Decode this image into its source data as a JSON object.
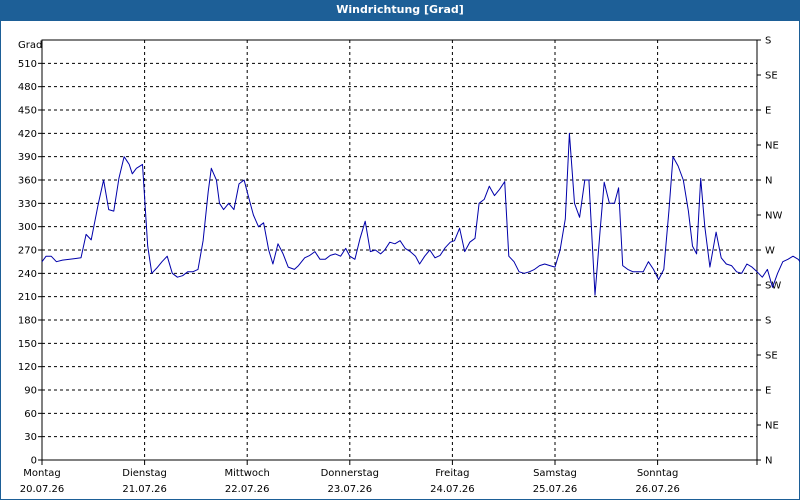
{
  "window": {
    "title": "Windrichtung [Grad]"
  },
  "chart_data": {
    "type": "line",
    "title": "Windrichtung [Grad]",
    "ylabel": "Grad",
    "ylim": [
      0,
      540
    ],
    "yticks": [
      0,
      30,
      60,
      90,
      120,
      150,
      180,
      210,
      240,
      270,
      300,
      330,
      360,
      390,
      420,
      450,
      480,
      510
    ],
    "right_axis_labels": [
      "N",
      "NE",
      "E",
      "SE",
      "S",
      "SW",
      "W",
      "NW",
      "N",
      "NE",
      "E",
      "SE",
      "S"
    ],
    "grid": true,
    "days": [
      {
        "name": "Montag",
        "date": "20.07.26"
      },
      {
        "name": "Dienstag",
        "date": "21.07.26"
      },
      {
        "name": "Mittwoch",
        "date": "22.07.26"
      },
      {
        "name": "Donnerstag",
        "date": "23.07.26"
      },
      {
        "name": "Freitag",
        "date": "24.07.26"
      },
      {
        "name": "Samstag",
        "date": "25.07.26"
      },
      {
        "name": "Sonntag",
        "date": "26.07.26"
      }
    ],
    "series": [
      {
        "color": "#0000aa",
        "x_unit": "days since Montag 20.07.26 00:00",
        "points": [
          [
            0.0,
            255
          ],
          [
            0.04,
            262
          ],
          [
            0.09,
            262
          ],
          [
            0.14,
            255
          ],
          [
            0.2,
            257
          ],
          [
            0.32,
            259
          ],
          [
            0.38,
            260
          ],
          [
            0.43,
            290
          ],
          [
            0.48,
            283
          ],
          [
            0.55,
            330
          ],
          [
            0.6,
            360
          ],
          [
            0.65,
            322
          ],
          [
            0.7,
            320
          ],
          [
            0.75,
            362
          ],
          [
            0.8,
            390
          ],
          [
            0.85,
            380
          ],
          [
            0.88,
            368
          ],
          [
            0.92,
            375
          ],
          [
            0.98,
            380
          ],
          [
            1.03,
            275
          ],
          [
            1.07,
            240
          ],
          [
            1.12,
            247
          ],
          [
            1.17,
            255
          ],
          [
            1.22,
            262
          ],
          [
            1.27,
            240
          ],
          [
            1.32,
            235
          ],
          [
            1.37,
            237
          ],
          [
            1.42,
            242
          ],
          [
            1.47,
            242
          ],
          [
            1.52,
            245
          ],
          [
            1.57,
            282
          ],
          [
            1.62,
            345
          ],
          [
            1.65,
            375
          ],
          [
            1.7,
            360
          ],
          [
            1.73,
            330
          ],
          [
            1.77,
            322
          ],
          [
            1.82,
            330
          ],
          [
            1.87,
            322
          ],
          [
            1.92,
            355
          ],
          [
            1.97,
            360
          ],
          [
            2.01,
            340
          ],
          [
            2.06,
            315
          ],
          [
            2.11,
            300
          ],
          [
            2.16,
            305
          ],
          [
            2.21,
            270
          ],
          [
            2.25,
            252
          ],
          [
            2.3,
            278
          ],
          [
            2.35,
            265
          ],
          [
            2.4,
            248
          ],
          [
            2.46,
            245
          ],
          [
            2.5,
            250
          ],
          [
            2.56,
            260
          ],
          [
            2.61,
            263
          ],
          [
            2.66,
            268
          ],
          [
            2.71,
            258
          ],
          [
            2.76,
            258
          ],
          [
            2.81,
            263
          ],
          [
            2.86,
            265
          ],
          [
            2.91,
            262
          ],
          [
            2.96,
            272
          ],
          [
            3.0,
            262
          ],
          [
            3.05,
            258
          ],
          [
            3.1,
            285
          ],
          [
            3.15,
            307
          ],
          [
            3.2,
            268
          ],
          [
            3.25,
            270
          ],
          [
            3.3,
            265
          ],
          [
            3.34,
            270
          ],
          [
            3.39,
            280
          ],
          [
            3.44,
            278
          ],
          [
            3.49,
            282
          ],
          [
            3.54,
            272
          ],
          [
            3.59,
            268
          ],
          [
            3.64,
            262
          ],
          [
            3.68,
            252
          ],
          [
            3.73,
            262
          ],
          [
            3.78,
            270
          ],
          [
            3.83,
            260
          ],
          [
            3.88,
            263
          ],
          [
            3.93,
            273
          ],
          [
            3.98,
            280
          ],
          [
            4.02,
            282
          ],
          [
            4.07,
            298
          ],
          [
            4.12,
            268
          ],
          [
            4.17,
            280
          ],
          [
            4.22,
            285
          ],
          [
            4.26,
            330
          ],
          [
            4.31,
            335
          ],
          [
            4.36,
            352
          ],
          [
            4.41,
            340
          ],
          [
            4.46,
            348
          ],
          [
            4.51,
            358
          ],
          [
            4.55,
            262
          ],
          [
            4.6,
            255
          ],
          [
            4.65,
            242
          ],
          [
            4.7,
            240
          ],
          [
            4.75,
            242
          ],
          [
            4.8,
            245
          ],
          [
            4.85,
            250
          ],
          [
            4.9,
            252
          ],
          [
            4.95,
            250
          ],
          [
            5.0,
            248
          ],
          [
            5.05,
            270
          ],
          [
            5.1,
            310
          ],
          [
            5.14,
            420
          ],
          [
            5.19,
            330
          ],
          [
            5.24,
            312
          ],
          [
            5.29,
            360
          ],
          [
            5.33,
            360
          ],
          [
            5.39,
            212
          ],
          [
            5.44,
            295
          ],
          [
            5.48,
            357
          ],
          [
            5.53,
            330
          ],
          [
            5.58,
            330
          ],
          [
            5.62,
            350
          ],
          [
            5.66,
            250
          ],
          [
            5.71,
            245
          ],
          [
            5.76,
            242
          ],
          [
            5.81,
            242
          ],
          [
            5.86,
            242
          ],
          [
            5.91,
            255
          ],
          [
            5.96,
            245
          ],
          [
            6.01,
            232
          ],
          [
            6.06,
            245
          ],
          [
            6.11,
            320
          ],
          [
            6.15,
            390
          ],
          [
            6.2,
            378
          ],
          [
            6.25,
            360
          ],
          [
            6.3,
            320
          ],
          [
            6.34,
            275
          ],
          [
            6.38,
            265
          ],
          [
            6.42,
            362
          ],
          [
            6.46,
            300
          ],
          [
            6.51,
            248
          ],
          [
            6.57,
            293
          ],
          [
            6.62,
            260
          ],
          [
            6.67,
            252
          ],
          [
            6.72,
            250
          ],
          [
            6.77,
            242
          ],
          [
            6.82,
            240
          ],
          [
            6.87,
            252
          ],
          [
            6.92,
            248
          ],
          [
            6.97,
            242
          ],
          [
            7.02,
            235
          ],
          [
            7.07,
            245
          ],
          [
            7.12,
            222
          ],
          [
            7.17,
            240
          ],
          [
            7.22,
            255
          ],
          [
            7.27,
            258
          ],
          [
            7.32,
            262
          ],
          [
            7.37,
            258
          ],
          [
            7.42,
            250
          ],
          [
            7.47,
            255
          ],
          [
            7.52,
            250
          ],
          [
            7.57,
            245
          ],
          [
            7.62,
            242
          ],
          [
            7.67,
            250
          ],
          [
            7.71,
            248
          ],
          [
            7.76,
            252
          ],
          [
            7.8,
            245
          ],
          [
            7.84,
            247
          ]
        ]
      }
    ]
  }
}
